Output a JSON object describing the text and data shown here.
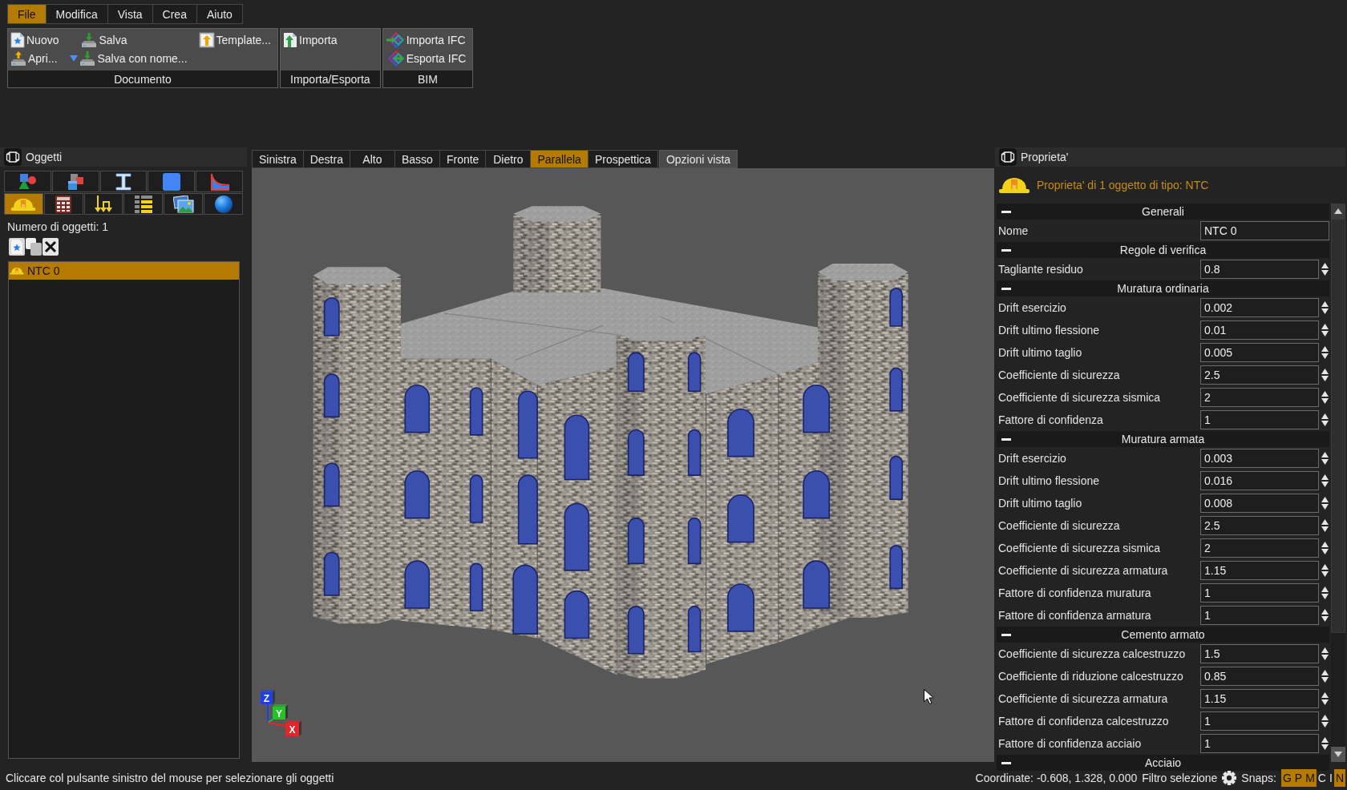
{
  "menu_tabs": [
    {
      "label": "File",
      "selected": true
    },
    {
      "label": "Modifica",
      "selected": false
    },
    {
      "label": "Vista",
      "selected": false
    },
    {
      "label": "Crea",
      "selected": false
    },
    {
      "label": "Aiuto",
      "selected": false
    }
  ],
  "ribbon": {
    "groups": [
      {
        "label": "Documento",
        "columns": [
          [
            {
              "label": "Nuovo",
              "dropdown": false
            },
            {
              "label": "Apri...",
              "dropdown": false
            }
          ],
          [
            {
              "label": "Salva",
              "dropdown": false
            },
            {
              "label": "Salva con nome...",
              "dropdown": true
            }
          ],
          [
            {
              "label": "Template...",
              "dropdown": false
            }
          ]
        ]
      },
      {
        "label": "Importa/Esporta",
        "columns": [
          [
            {
              "label": "Importa",
              "dropdown": false
            }
          ]
        ]
      },
      {
        "label": "BIM",
        "columns": [
          [
            {
              "label": "Importa IFC",
              "dropdown": false
            },
            {
              "label": "Esporta IFC",
              "dropdown": false
            }
          ]
        ]
      }
    ]
  },
  "objects_panel": {
    "title": "Oggetti",
    "category_tabs": [
      [
        {
          "selected": false
        },
        {
          "selected": false
        },
        {
          "selected": false
        },
        {
          "selected": false
        },
        {
          "selected": false
        }
      ],
      [
        {
          "selected": true
        },
        {
          "selected": false
        },
        {
          "selected": false
        },
        {
          "selected": false
        },
        {
          "selected": false
        },
        {
          "selected": false
        }
      ]
    ],
    "count_label": "Numero di oggetti: 1",
    "items": [
      {
        "label": "NTC 0",
        "selected": true
      }
    ]
  },
  "viewport": {
    "view_tabs": [
      {
        "label": "Sinistra",
        "selected": false
      },
      {
        "label": "Destra",
        "selected": false
      },
      {
        "label": "Alto",
        "selected": false
      },
      {
        "label": "Basso",
        "selected": false
      },
      {
        "label": "Fronte",
        "selected": false
      },
      {
        "label": "Dietro",
        "selected": false
      },
      {
        "label": "Parallela",
        "selected": true
      },
      {
        "label": "Prospettica",
        "selected": false
      }
    ],
    "options_button": "Opzioni vista",
    "axis_gizmo": {
      "axes": [
        {
          "label": "Z",
          "color": "#1f3fe8"
        },
        {
          "label": "Y",
          "color": "#22c42a"
        },
        {
          "label": "X",
          "color": "#e8242a"
        }
      ]
    }
  },
  "properties_panel": {
    "title": "Proprieta'",
    "subtitle": "Proprieta' di 1 oggetto di tipo: NTC",
    "sections": [
      {
        "title": "Generali",
        "expanded": true,
        "rows": [
          {
            "label": "Nome",
            "value": "NTC 0",
            "kind": "text"
          }
        ]
      },
      {
        "title": "Regole di verifica",
        "expanded": true,
        "rows": [
          {
            "label": "Tagliante residuo",
            "value": "0.8",
            "kind": "number"
          }
        ]
      },
      {
        "title": "Muratura ordinaria",
        "expanded": true,
        "rows": [
          {
            "label": "Drift esercizio",
            "value": "0.002",
            "kind": "number"
          },
          {
            "label": "Drift ultimo flessione",
            "value": "0.01",
            "kind": "number"
          },
          {
            "label": "Drift ultimo taglio",
            "value": "0.005",
            "kind": "number"
          },
          {
            "label": "Coefficiente di sicurezza",
            "value": "2.5",
            "kind": "number"
          },
          {
            "label": "Coefficiente di sicurezza sismica",
            "value": "2",
            "kind": "number"
          },
          {
            "label": "Fattore di confidenza",
            "value": "1",
            "kind": "number"
          }
        ]
      },
      {
        "title": "Muratura armata",
        "expanded": true,
        "rows": [
          {
            "label": "Drift esercizio",
            "value": "0.003",
            "kind": "number"
          },
          {
            "label": "Drift ultimo flessione",
            "value": "0.016",
            "kind": "number"
          },
          {
            "label": "Drift ultimo taglio",
            "value": "0.008",
            "kind": "number"
          },
          {
            "label": "Coefficiente di sicurezza",
            "value": "2.5",
            "kind": "number"
          },
          {
            "label": "Coefficiente di sicurezza sismica",
            "value": "2",
            "kind": "number"
          },
          {
            "label": "Coefficiente di sicurezza armatura",
            "value": "1.15",
            "kind": "number"
          },
          {
            "label": "Fattore di confidenza muratura",
            "value": "1",
            "kind": "number"
          },
          {
            "label": "Fattore di confidenza armatura",
            "value": "1",
            "kind": "number"
          }
        ]
      },
      {
        "title": "Cemento armato",
        "expanded": true,
        "rows": [
          {
            "label": "Coefficiente di sicurezza calcestruzzo",
            "value": "1.5",
            "kind": "number"
          },
          {
            "label": "Coefficiente di riduzione calcestruzzo",
            "value": "0.85",
            "kind": "number"
          },
          {
            "label": "Coefficiente di sicurezza armatura",
            "value": "1.15",
            "kind": "number"
          },
          {
            "label": "Fattore di confidenza calcestruzzo",
            "value": "1",
            "kind": "number"
          },
          {
            "label": "Fattore di confidenza acciaio",
            "value": "1",
            "kind": "number"
          }
        ]
      },
      {
        "title": "Acciaio",
        "expanded": true
      }
    ]
  },
  "status_bar": {
    "message": "Cliccare col pulsante sinistro del mouse per selezionare gli oggetti",
    "coordinates": "Coordinate: -0.608, 1.328, 0.000",
    "filter_label": "Filtro selezione",
    "snaps_label": "Snaps:",
    "snaps": [
      {
        "label": "G",
        "on": true
      },
      {
        "label": "P",
        "on": true
      },
      {
        "label": "M",
        "on": true
      },
      {
        "label": "C",
        "on": false
      },
      {
        "label": "I",
        "on": false
      },
      {
        "label": "N",
        "on": true
      }
    ]
  }
}
